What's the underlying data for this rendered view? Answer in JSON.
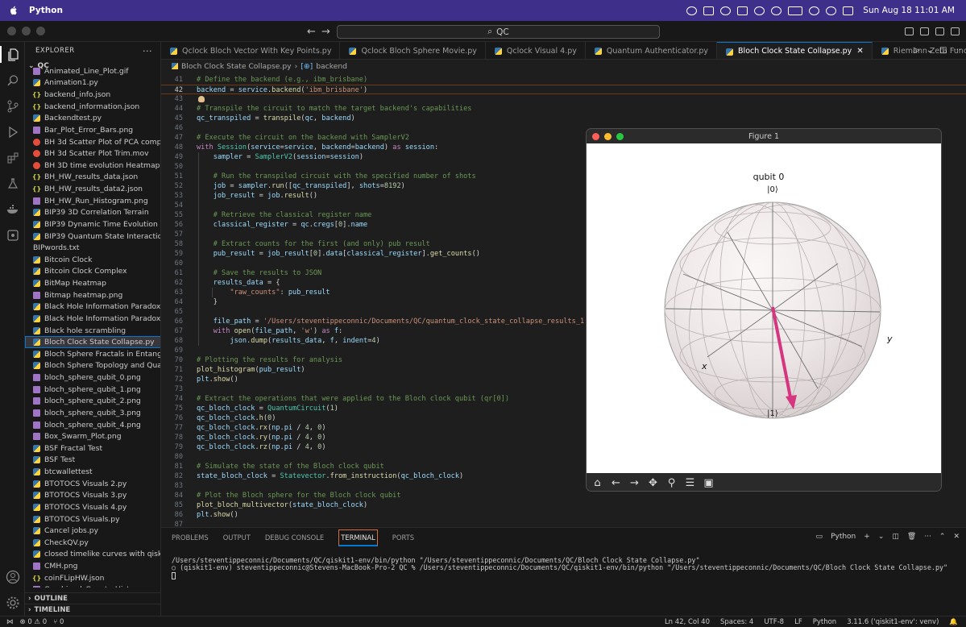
{
  "menubar": {
    "app_name": "Python",
    "datetime": "Sun Aug 18  11:01 AM"
  },
  "window": {
    "search": "QC"
  },
  "explorer": {
    "title": "EXPLORER",
    "root": "QC",
    "files": [
      {
        "name": "Animated_Line_Plot.gif",
        "type": "img"
      },
      {
        "name": "Animation1.py",
        "type": "py"
      },
      {
        "name": "backend_info.json",
        "type": "json"
      },
      {
        "name": "backend_information.json",
        "type": "json"
      },
      {
        "name": "Backendtest.py",
        "type": "py"
      },
      {
        "name": "Bar_Plot_Error_Bars.png",
        "type": "img"
      },
      {
        "name": "BH 3d Scatter Plot of PCA compo...",
        "type": "mov"
      },
      {
        "name": "BH 3d Scatter Plot Trim.mov",
        "type": "mov"
      },
      {
        "name": "BH 3D time evolution Heatmap.mov",
        "type": "mov"
      },
      {
        "name": "BH_HW_results_data.json",
        "type": "json"
      },
      {
        "name": "BH_HW_results_data2.json",
        "type": "json"
      },
      {
        "name": "BH_HW_Run_Histogram.png",
        "type": "img"
      },
      {
        "name": "BIP39 3D Correlation Terrain",
        "type": "py"
      },
      {
        "name": "BIP39 Dynamic Time Evolution Su...",
        "type": "py"
      },
      {
        "name": "BIP39 Quantum State Interaction ...",
        "type": "py"
      },
      {
        "name": "BIPwords.txt",
        "type": "none"
      },
      {
        "name": "Bitcoin Clock",
        "type": "py"
      },
      {
        "name": "Bitcoin Clock Complex",
        "type": "py"
      },
      {
        "name": "BitMap Heatmap",
        "type": "py"
      },
      {
        "name": "Bitmap heatmap.png",
        "type": "img"
      },
      {
        "name": "Black Hole Information Paradox in ...",
        "type": "py"
      },
      {
        "name": "Black Hole Information Paradox in ...",
        "type": "py"
      },
      {
        "name": "Black hole scrambling",
        "type": "py"
      },
      {
        "name": "Bloch Clock State Collapse.py",
        "type": "py",
        "selected": true
      },
      {
        "name": "Bloch Sphere Fractals in Entangle...",
        "type": "py"
      },
      {
        "name": "Bloch Sphere Topology and Quant...",
        "type": "py"
      },
      {
        "name": "bloch_sphere_qubit_0.png",
        "type": "img"
      },
      {
        "name": "bloch_sphere_qubit_1.png",
        "type": "img"
      },
      {
        "name": "bloch_sphere_qubit_2.png",
        "type": "img"
      },
      {
        "name": "bloch_sphere_qubit_3.png",
        "type": "img"
      },
      {
        "name": "bloch_sphere_qubit_4.png",
        "type": "img"
      },
      {
        "name": "Box_Swarm_Plot.png",
        "type": "img"
      },
      {
        "name": "BSF Fractal Test",
        "type": "py"
      },
      {
        "name": "BSF Test",
        "type": "py"
      },
      {
        "name": "btcwallettest",
        "type": "py"
      },
      {
        "name": "BTOTOCS Visuals 2.py",
        "type": "py"
      },
      {
        "name": "BTOTOCS Visuals 3.py",
        "type": "py"
      },
      {
        "name": "BTOTOCS Visuals 4.py",
        "type": "py"
      },
      {
        "name": "BTOTOCS Visuals.py",
        "type": "py"
      },
      {
        "name": "Cancel jobs.py",
        "type": "py"
      },
      {
        "name": "CheckQV.py",
        "type": "py"
      },
      {
        "name": "closed timelike curves with qiskit",
        "type": "py"
      },
      {
        "name": "CMH.png",
        "type": "img"
      },
      {
        "name": "coinFLipHW.json",
        "type": "json"
      },
      {
        "name": "Combined_Counts_Histogram.png",
        "type": "img"
      }
    ],
    "outline": "OUTLINE",
    "timeline": "TIMELINE"
  },
  "tabs": [
    {
      "label": "Qclock Bloch Vector With Key Points.py"
    },
    {
      "label": "Qclock Bloch Sphere Movie.py"
    },
    {
      "label": "Qclock Visual 4.py"
    },
    {
      "label": "Quantum Authenticator.py"
    },
    {
      "label": "Bloch Clock State Collapse.py",
      "active": true
    },
    {
      "label": "Riemann Zeta Function Re"
    }
  ],
  "breadcrumb": {
    "file": "Bloch Clock State Collapse.py",
    "symbol": "backend"
  },
  "code_lines": [
    {
      "n": "41",
      "html": "<span class='c'># Define the backend (e.g., ibm_brisbane)</span>"
    },
    {
      "n": "42",
      "html": "<span class='v'>backend</span> = <span class='v'>service</span>.<span class='f'>backend</span>(<span class='s'>'ibm_brisbane'</span>)",
      "cur": true
    },
    {
      "n": "43",
      "html": "",
      "bulb": true
    },
    {
      "n": "44",
      "html": "<span class='c'># Transpile the circuit to match the target backend's capabilities</span>"
    },
    {
      "n": "45",
      "html": "<span class='v'>qc_transpiled</span> = <span class='f'>transpile</span>(<span class='v'>qc</span>, <span class='v'>backend</span>)"
    },
    {
      "n": "46",
      "html": ""
    },
    {
      "n": "47",
      "html": "<span class='c'># Execute the circuit on the backend with SamplerV2</span>"
    },
    {
      "n": "48",
      "html": "<span class='k'>with</span> <span class='t'>Session</span>(<span class='v'>service</span>=<span class='v'>service</span>, <span class='v'>backend</span>=<span class='v'>backend</span>) <span class='k'>as</span> <span class='v'>session</span>:"
    },
    {
      "n": "49",
      "html": "    <span class='v'>sampler</span> = <span class='t'>SamplerV2</span>(<span class='v'>session</span>=<span class='v'>session</span>)"
    },
    {
      "n": "50",
      "html": ""
    },
    {
      "n": "51",
      "html": "    <span class='c'># Run the transpiled circuit with the specified number of shots</span>"
    },
    {
      "n": "52",
      "html": "    <span class='v'>job</span> = <span class='v'>sampler</span>.<span class='f'>run</span>([<span class='v'>qc_transpiled</span>], <span class='v'>shots</span>=<span class='n'>8192</span>)"
    },
    {
      "n": "53",
      "html": "    <span class='v'>job_result</span> = <span class='v'>job</span>.<span class='f'>result</span>()"
    },
    {
      "n": "54",
      "html": ""
    },
    {
      "n": "55",
      "html": "    <span class='c'># Retrieve the classical register name</span>"
    },
    {
      "n": "56",
      "html": "    <span class='v'>classical_register</span> = <span class='v'>qc</span>.<span class='v'>cregs</span>[<span class='n'>0</span>].<span class='v'>name</span>"
    },
    {
      "n": "57",
      "html": ""
    },
    {
      "n": "58",
      "html": "    <span class='c'># Extract counts for the first (and only) pub result</span>"
    },
    {
      "n": "59",
      "html": "    <span class='v'>pub_result</span> = <span class='v'>job_result</span>[<span class='n'>0</span>].<span class='v'>data</span>[<span class='v'>classical_register</span>].<span class='f'>get_counts</span>()"
    },
    {
      "n": "60",
      "html": ""
    },
    {
      "n": "61",
      "html": "    <span class='c'># Save the results to JSON</span>"
    },
    {
      "n": "62",
      "html": "    <span class='v'>results_data</span> = {"
    },
    {
      "n": "63",
      "html": "        <span class='s'>\"raw_counts\"</span>: <span class='v'>pub_result</span>"
    },
    {
      "n": "64",
      "html": "    }"
    },
    {
      "n": "65",
      "html": ""
    },
    {
      "n": "66",
      "html": "    <span class='v'>file_path</span> = <span class='s'>'/Users/steventippeconnic/Documents/QC/quantum_clock_state_collapse_results_1.json'</span>"
    },
    {
      "n": "67",
      "html": "    <span class='k'>with</span> <span class='f'>open</span>(<span class='v'>file_path</span>, <span class='s'>'w'</span>) <span class='k'>as</span> <span class='v'>f</span>:"
    },
    {
      "n": "68",
      "html": "        <span class='v'>json</span>.<span class='f'>dump</span>(<span class='v'>results_data</span>, <span class='v'>f</span>, <span class='v'>indent</span>=<span class='n'>4</span>)"
    },
    {
      "n": "69",
      "html": ""
    },
    {
      "n": "70",
      "html": "<span class='c'># Plotting the results for analysis</span>"
    },
    {
      "n": "71",
      "html": "<span class='f'>plot_histogram</span>(<span class='v'>pub_result</span>)"
    },
    {
      "n": "72",
      "html": "<span class='v'>plt</span>.<span class='f'>show</span>()"
    },
    {
      "n": "73",
      "html": ""
    },
    {
      "n": "74",
      "html": "<span class='c'># Extract the operations that were applied to the Bloch clock qubit (qr[0])</span>"
    },
    {
      "n": "75",
      "html": "<span class='v'>qc_bloch_clock</span> = <span class='t'>QuantumCircuit</span>(<span class='n'>1</span>)"
    },
    {
      "n": "76",
      "html": "<span class='v'>qc_bloch_clock</span>.<span class='f'>h</span>(<span class='n'>0</span>)"
    },
    {
      "n": "77",
      "html": "<span class='v'>qc_bloch_clock</span>.<span class='f'>rx</span>(<span class='v'>np</span>.<span class='v'>pi</span> / <span class='n'>4</span>, <span class='n'>0</span>)"
    },
    {
      "n": "78",
      "html": "<span class='v'>qc_bloch_clock</span>.<span class='f'>ry</span>(<span class='v'>np</span>.<span class='v'>pi</span> / <span class='n'>4</span>, <span class='n'>0</span>)"
    },
    {
      "n": "79",
      "html": "<span class='v'>qc_bloch_clock</span>.<span class='f'>rz</span>(<span class='v'>np</span>.<span class='v'>pi</span> / <span class='n'>4</span>, <span class='n'>0</span>)"
    },
    {
      "n": "80",
      "html": ""
    },
    {
      "n": "81",
      "html": "<span class='c'># Simulate the state of the Bloch clock qubit</span>"
    },
    {
      "n": "82",
      "html": "<span class='v'>state_bloch_clock</span> = <span class='t'>Statevector</span>.<span class='f'>from_instruction</span>(<span class='v'>qc_bloch_clock</span>)"
    },
    {
      "n": "83",
      "html": ""
    },
    {
      "n": "84",
      "html": "<span class='c'># Plot the Bloch sphere for the Bloch clock qubit</span>"
    },
    {
      "n": "85",
      "html": "<span class='f'>plot_bloch_multivector</span>(<span class='v'>state_bloch_clock</span>)"
    },
    {
      "n": "86",
      "html": "<span class='v'>plt</span>.<span class='f'>show</span>()"
    },
    {
      "n": "87",
      "html": ""
    }
  ],
  "figure": {
    "title": "Figure 1",
    "qubit_label": "qubit 0",
    "ket0": "|0⟩",
    "ket1": "|1⟩",
    "x_label": "x",
    "y_label": "y",
    "vector_color": "#d6357f"
  },
  "panel": {
    "tabs": [
      "PROBLEMS",
      "OUTPUT",
      "DEBUG CONSOLE",
      "TERMINAL",
      "PORTS"
    ],
    "active_tab": "TERMINAL",
    "shell": "Python",
    "terminal_lines": [
      "/Users/steventippeconnic/Documents/QC/qiskit1-env/bin/python \"/Users/steventippeconnic/Documents/QC/Bloch Clock State Collapse.py\"",
      "(qiskit1-env) steventippeconnic@Stevens-MacBook-Pro-2 QC % /Users/steventippeconnic/Documents/QC/qiskit1-env/bin/python \"/Users/steventippeconnic/Documents/QC/Bloch Clock State Collapse.py\""
    ]
  },
  "statusbar": {
    "errors": "⊗ 0 ⚠ 0",
    "ports": "⑂ 0",
    "position": "Ln 42, Col 40",
    "spaces": "Spaces: 4",
    "encoding": "UTF-8",
    "eol": "LF",
    "language": "Python",
    "interpreter": "3.11.6 ('qiskit1-env': venv)"
  },
  "colors": {
    "menubar": "#3d2f8a",
    "accent": "#0078d4"
  }
}
